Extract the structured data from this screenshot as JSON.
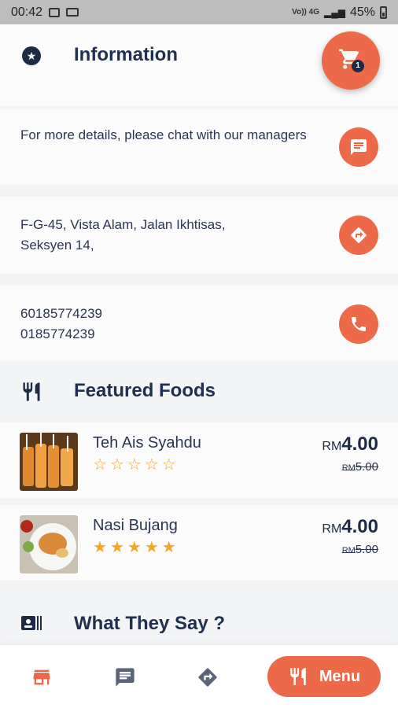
{
  "status_bar": {
    "time": "00:42",
    "signal_label": "Vo)) 4G",
    "battery": "45%"
  },
  "info": {
    "title": "Information",
    "cart_count": "1"
  },
  "contact": {
    "chat_text": "For more details, please chat with our managers",
    "address_line1": "F-G-45, Vista Alam, Jalan Ikhtisas,",
    "address_line2": "Seksyen 14,",
    "phone1": "60185774239",
    "phone2": "0185774239"
  },
  "featured": {
    "title": "Featured Foods",
    "items": [
      {
        "name": "Teh Ais Syahdu",
        "rating": 0,
        "currency": "RM",
        "price": "4.00",
        "old_currency": "RM",
        "old_price": "5.00"
      },
      {
        "name": "Nasi Bujang",
        "rating": 5,
        "currency": "RM",
        "price": "4.00",
        "old_currency": "RM",
        "old_price": "5.00"
      }
    ]
  },
  "testimonials": {
    "title": "What They Say ?"
  },
  "bottom_nav": {
    "menu_label": "Menu"
  },
  "colors": {
    "accent": "#ec6a4a",
    "navy": "#1f2a44",
    "star": "#f5a623"
  }
}
